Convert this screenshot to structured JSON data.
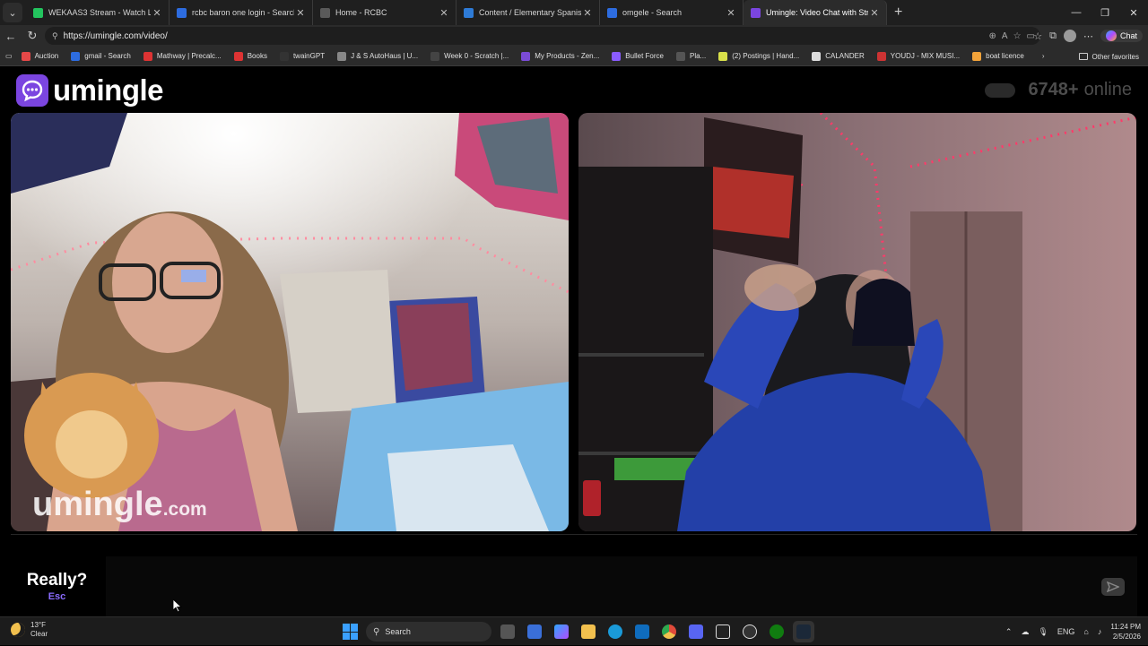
{
  "browser": {
    "tabs": [
      {
        "title": "WEKAAS3 Stream - Watch Live on",
        "color": "#23c45e",
        "active": false
      },
      {
        "title": "rcbc baron one login - Search",
        "color": "#2d6cdf",
        "active": false
      },
      {
        "title": "Home - RCBC",
        "color": "#5a5a5a",
        "active": false
      },
      {
        "title": "Content / Elementary Spanish I (SP",
        "color": "#2e7bd6",
        "active": false
      },
      {
        "title": "omgele - Search",
        "color": "#2d6cdf",
        "active": false
      },
      {
        "title": "Umingle: Video Chat with Stra",
        "color": "#7b45e0",
        "active": true
      }
    ],
    "url": "https://umingle.com/video/",
    "copilot_label": "Chat",
    "bookmarks": [
      {
        "label": "Auction",
        "color": "#e54848"
      },
      {
        "label": "gmail - Search",
        "color": "#2d6cdf"
      },
      {
        "label": "Mathway | Precalc...",
        "color": "#d33"
      },
      {
        "label": "Books",
        "color": "#d33"
      },
      {
        "label": "twainGPT",
        "color": "#333"
      },
      {
        "label": "J & S AutoHaus | U...",
        "color": "#888"
      },
      {
        "label": "Week 0 - Scratch |...",
        "color": "#444"
      },
      {
        "label": "My Products - Zen...",
        "color": "#7a4bd6"
      },
      {
        "label": "Bullet Force",
        "color": "#8a5cff"
      },
      {
        "label": "Pla...",
        "color": "#555"
      },
      {
        "label": "(2) Postings | Hand...",
        "color": "#d8e04a"
      },
      {
        "label": "CALANDER",
        "color": "#ddd"
      },
      {
        "label": "YOUDJ - MIX MUSI...",
        "color": "#c33"
      },
      {
        "label": "boat licence",
        "color": "#f2a33a"
      }
    ],
    "other_bookmarks": "Other favorites"
  },
  "page": {
    "logo_text": "umingle",
    "online_count": "6748+",
    "online_label": "online",
    "watermark_main": "umingle",
    "watermark_suffix": ".com",
    "esc_button": {
      "title": "Really?",
      "key": "Esc"
    },
    "chat_input": {
      "value": "",
      "placeholder": ""
    },
    "accent": "#7b45e0"
  },
  "taskbar": {
    "weather_temp": "13°F",
    "weather_desc": "Clear",
    "search_label": "Search",
    "language": "ENG",
    "time": "11:24 PM",
    "date": "2/5/2026"
  }
}
